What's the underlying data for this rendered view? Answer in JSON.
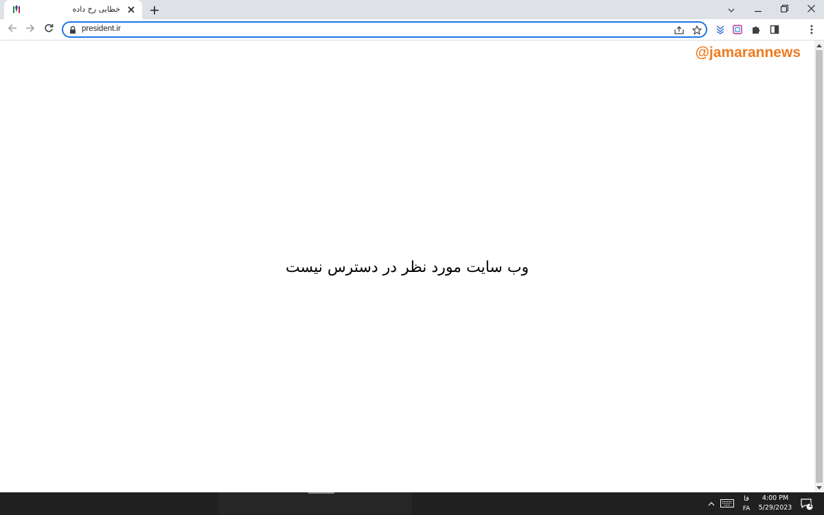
{
  "browser": {
    "tab": {
      "title": "خطایی رخ داده"
    },
    "address_bar": {
      "url": "president.ir"
    }
  },
  "page": {
    "watermark": "@jamarannews",
    "error_message": "وب سایت مورد نظر در دسترس نیست"
  },
  "taskbar": {
    "language_script": "فا",
    "language_code": "FA",
    "time": "4:00 PM",
    "date": "5/29/2023",
    "notification_count": "1"
  },
  "colors": {
    "accent": "#1a73e8",
    "watermark": "#f07a1e",
    "tabstrip": "#dee1e6",
    "taskbar": "#202020"
  }
}
